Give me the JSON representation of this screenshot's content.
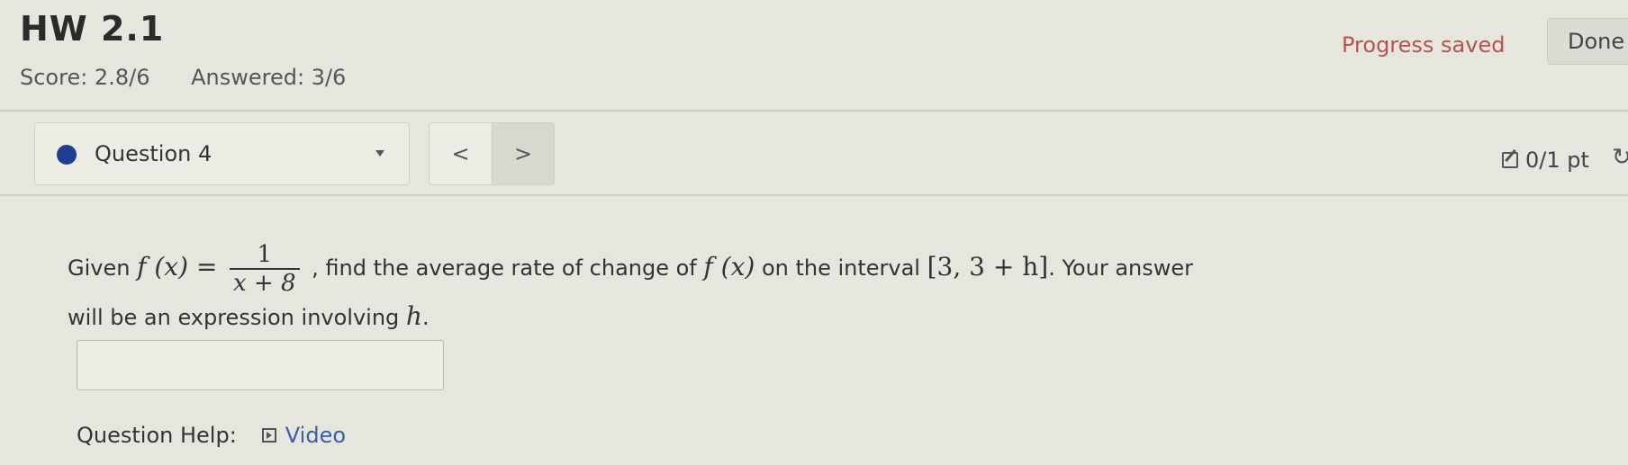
{
  "header": {
    "title": "HW 2.1",
    "score_text": "Score: 2.8/6",
    "answered_text": "Answered: 3/6",
    "progress_status": "Progress saved",
    "done_label": "Done"
  },
  "question_nav": {
    "selected_question": "Question 4",
    "prev_label": "<",
    "next_label": ">",
    "points": "0/1 pt",
    "refresh_icon": "↻"
  },
  "question": {
    "given": "Given",
    "f_of_x": "f (x) =",
    "numerator": "1",
    "denominator": "x + 8",
    "mid_text": ", find the average rate of change of",
    "f_of_x_2": "f (x)",
    "interval_text": "on the interval",
    "interval": "[3, 3 + h]",
    "tail_text": ". Your answer",
    "line2_prefix": "will be an expression involving",
    "h": "h",
    "line2_suffix": "."
  },
  "answer_input": {
    "value": ""
  },
  "help": {
    "label": "Question Help:",
    "video_label": "Video"
  }
}
